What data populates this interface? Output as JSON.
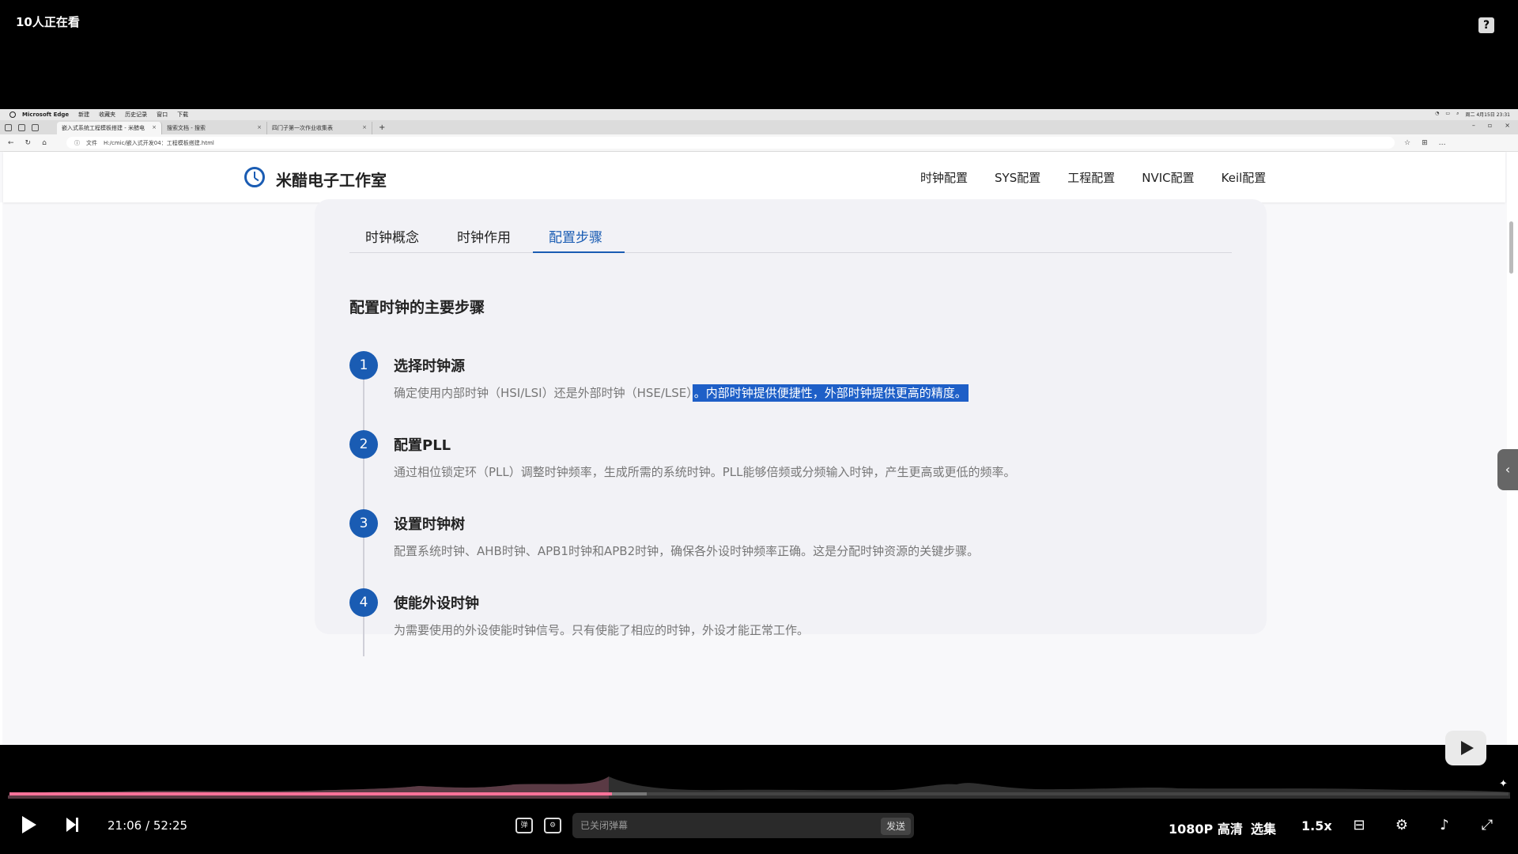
{
  "top": {
    "viewer_count": "10人正在看",
    "help_label": "?"
  },
  "os": {
    "app": "Microsoft Edge",
    "menus": [
      "新建",
      "收藏夹",
      "历史记录",
      "窗口",
      "下载"
    ],
    "clock": "周二 4月15日 23:31"
  },
  "browser": {
    "tabs": [
      {
        "label": "嵌入式系统工程模板搭建 - 米醋电",
        "active": true
      },
      {
        "label": "搜索文档 - 搜索",
        "active": false
      },
      {
        "label": "四门子第一次作业收集表",
        "active": false
      }
    ],
    "file_label": "文件",
    "url": "H:/cmic/嵌入式开发04：工程模板搭建.html"
  },
  "site": {
    "title": "米醋电子工作室",
    "nav": [
      "时钟配置",
      "SYS配置",
      "工程配置",
      "NVIC配置",
      "Keil配置"
    ],
    "tabs": [
      "时钟概念",
      "时钟作用",
      "配置步骤"
    ],
    "active_tab": "配置步骤",
    "heading": "配置时钟的主要步骤",
    "steps": [
      {
        "num": "1",
        "title": "选择时钟源",
        "desc": "确定使用内部时钟（HSI/LSI）还是外部时钟（HSE/LSE）",
        "desc_highlight": "。内部时钟提供便捷性，外部时钟提供更高的精度。"
      },
      {
        "num": "2",
        "title": "配置PLL",
        "desc": "通过相位锁定环（PLL）调整时钟频率，生成所需的系统时钟。PLL能够倍频或分频输入时钟，产生更高或更低的频率。",
        "desc_highlight": ""
      },
      {
        "num": "3",
        "title": "设置时钟树",
        "desc": "配置系统时钟、AHB时钟、APB1时钟和APB2时钟，确保各外设时钟频率正确。这是分配时钟资源的关键步骤。",
        "desc_highlight": ""
      },
      {
        "num": "4",
        "title": "使能外设时钟",
        "desc": "为需要使用的外设使能时钟信号。只有使能了相应的时钟，外设才能正常工作。",
        "desc_highlight": ""
      }
    ]
  },
  "player": {
    "current_time": "21:06",
    "separator": "/",
    "total_time": "52:25",
    "progress_fraction": 0.402,
    "danmaku_placeholder": "已关闭弹幕",
    "send_label": "发送",
    "quality": "1080P 高清",
    "episodes": "选集",
    "speed": "1.5x",
    "accent": "#fb7299"
  },
  "colors": {
    "brand": "#1a5cb3",
    "highlight": "#1e5fc7"
  }
}
